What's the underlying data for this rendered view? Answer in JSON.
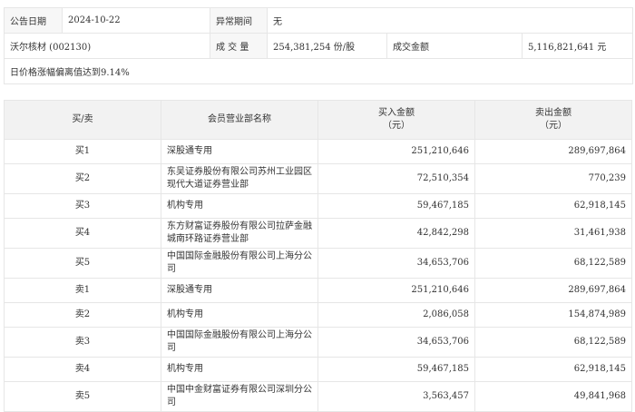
{
  "info": {
    "date_label": "公告日期",
    "date": "2024-10-22",
    "period_label": "异常期间",
    "period": "无",
    "stock": "沃尔核材 (002130)",
    "volume_label": "成 交 量",
    "volume": "254,381,254 份/股",
    "amount_label": "成交金额",
    "amount": "5,116,821,641 元",
    "reason": "日价格涨幅偏离值达到9.14%"
  },
  "table": {
    "headers": [
      "买/卖",
      "会员营业部名称",
      "买入金额\n（元）",
      "卖出金额\n（元）"
    ],
    "rows": [
      {
        "side": "买1",
        "name": "深股通专用",
        "buy": "251,210,646",
        "sell": "289,697,864"
      },
      {
        "side": "买2",
        "name": "东吴证券股份有限公司苏州工业园区现代大道证券营业部",
        "buy": "72,510,354",
        "sell": "770,239"
      },
      {
        "side": "买3",
        "name": "机构专用",
        "buy": "59,467,185",
        "sell": "62,918,145"
      },
      {
        "side": "买4",
        "name": "东方财富证券股份有限公司拉萨金融城南环路证券营业部",
        "buy": "42,842,298",
        "sell": "31,461,938"
      },
      {
        "side": "买5",
        "name": "中国国际金融股份有限公司上海分公司",
        "buy": "34,653,706",
        "sell": "68,122,589"
      },
      {
        "side": "卖1",
        "name": "深股通专用",
        "buy": "251,210,646",
        "sell": "289,697,864"
      },
      {
        "side": "卖2",
        "name": "机构专用",
        "buy": "2,086,058",
        "sell": "154,874,989"
      },
      {
        "side": "卖3",
        "name": "中国国际金融股份有限公司上海分公司",
        "buy": "34,653,706",
        "sell": "68,122,589"
      },
      {
        "side": "卖4",
        "name": "机构专用",
        "buy": "59,467,185",
        "sell": "62,918,145"
      },
      {
        "side": "卖5",
        "name": "中国中金财富证券有限公司深圳分公司",
        "buy": "3,563,457",
        "sell": "49,841,968"
      }
    ]
  }
}
